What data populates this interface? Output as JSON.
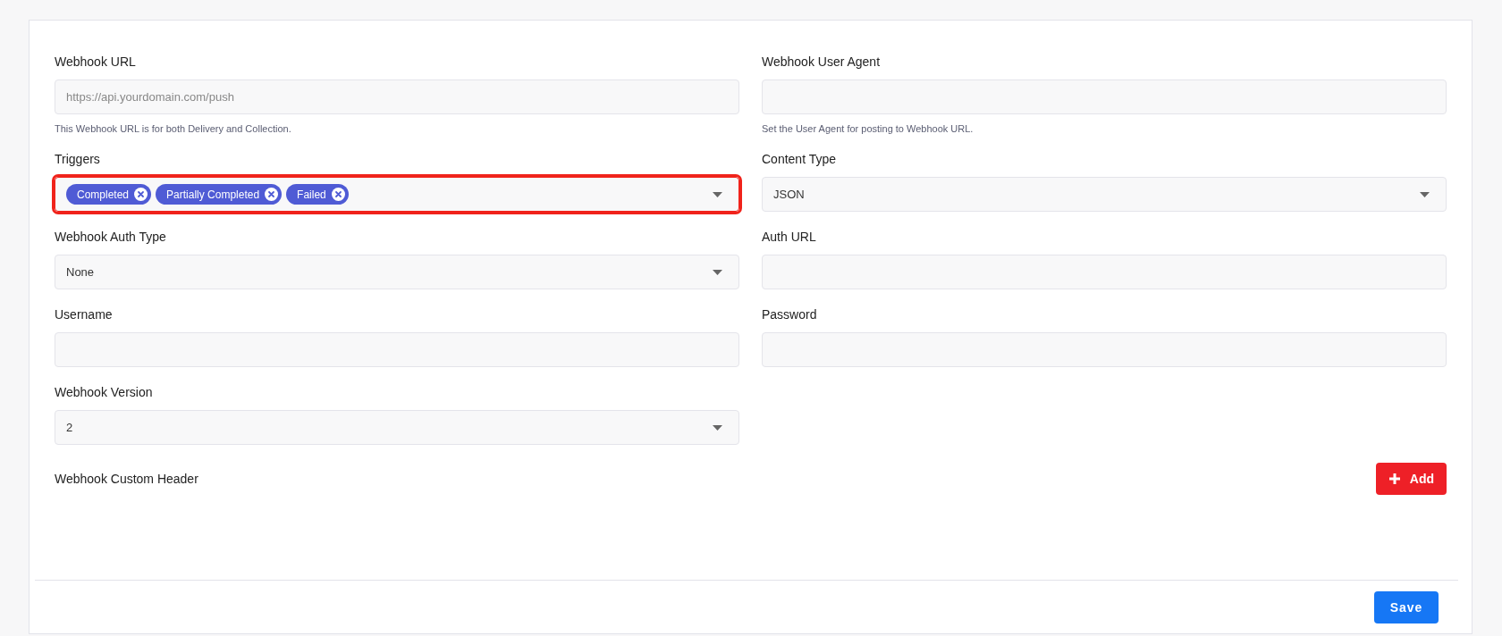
{
  "rows": [
    {
      "fields": [
        {
          "label": "Webhook URL",
          "kind": "input",
          "placeholder": "https://api.yourdomain.com/push",
          "help": "This Webhook URL is for both Delivery and Collection."
        },
        {
          "label": "Webhook User Agent",
          "kind": "input",
          "help": "Set the User Agent for posting to Webhook URL."
        }
      ]
    },
    {
      "fields": [
        {
          "label": "Triggers",
          "kind": "multiselect",
          "highlighted": true,
          "tags": [
            "Completed",
            "Partially Completed",
            "Failed"
          ]
        },
        {
          "label": "Content Type",
          "kind": "select",
          "value": "JSON"
        }
      ]
    },
    {
      "fields": [
        {
          "label": "Webhook Auth Type",
          "kind": "select",
          "value": "None"
        },
        {
          "label": "Auth URL",
          "kind": "input"
        }
      ]
    },
    {
      "fields": [
        {
          "label": "Username",
          "kind": "input"
        },
        {
          "label": "Password",
          "kind": "input"
        }
      ]
    },
    {
      "fields": [
        {
          "label": "Webhook Version",
          "kind": "select",
          "value": "2"
        }
      ]
    }
  ],
  "custom_header": {
    "label": "Webhook Custom Header",
    "button": "Add"
  },
  "save_button": "Save"
}
